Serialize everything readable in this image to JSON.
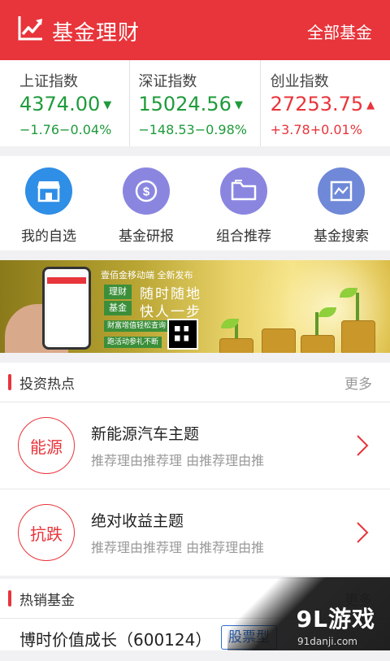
{
  "header": {
    "title": "基金理财",
    "all_funds": "全部基金",
    "logo_icon": "chart-trend-icon"
  },
  "indices": [
    {
      "name": "上证指数",
      "value": "4374.00",
      "change": "−1.76−0.04%",
      "direction": "down",
      "color": "#1f9b3b"
    },
    {
      "name": "深证指数",
      "value": "15024.56",
      "change": "−148.53−0.98%",
      "direction": "down",
      "color": "#1f9b3b"
    },
    {
      "name": "创业指数",
      "value": "27253.75",
      "change": "+3.78+0.01%",
      "direction": "up",
      "color": "#e8343b"
    }
  ],
  "quick_actions": [
    {
      "label": "我的自选",
      "icon": "store-icon",
      "color": "#2f8ee5"
    },
    {
      "label": "基金研报",
      "icon": "dollar-coin-icon",
      "color": "#8a86e0"
    },
    {
      "label": "组合推荐",
      "icon": "folder-icon",
      "color": "#8a86e0"
    },
    {
      "label": "基金搜索",
      "icon": "chart-window-icon",
      "color": "#6f88d8"
    }
  ],
  "banner": {
    "slogan": "壹佰金移动端   全新发布",
    "tag1": "理财",
    "tag2": "基金",
    "line1": "随时随地",
    "line2": "快人一步",
    "sub1": "财富增值轻松查询",
    "sub2": "跑活动参礼不断"
  },
  "hot": {
    "title": "投资热点",
    "more": "更多",
    "items": [
      {
        "badge": "能源",
        "name": "新能源汽车主题",
        "reason": "推荐理由推荐理 由推荐理由推"
      },
      {
        "badge": "抗跌",
        "name": "绝对收益主题",
        "reason": "推荐理由推荐理 由推荐理由推"
      }
    ]
  },
  "bestsellers": {
    "title": "热销基金",
    "more": "更多",
    "first": {
      "name": "博时价值成长（600124）",
      "type": "股票型"
    }
  },
  "watermark": {
    "logo": "9L游戏",
    "url": "91danji.com"
  },
  "colors": {
    "brand_red": "#e8343b",
    "down_green": "#1f9b3b",
    "type_blue": "#2e6fcf"
  }
}
